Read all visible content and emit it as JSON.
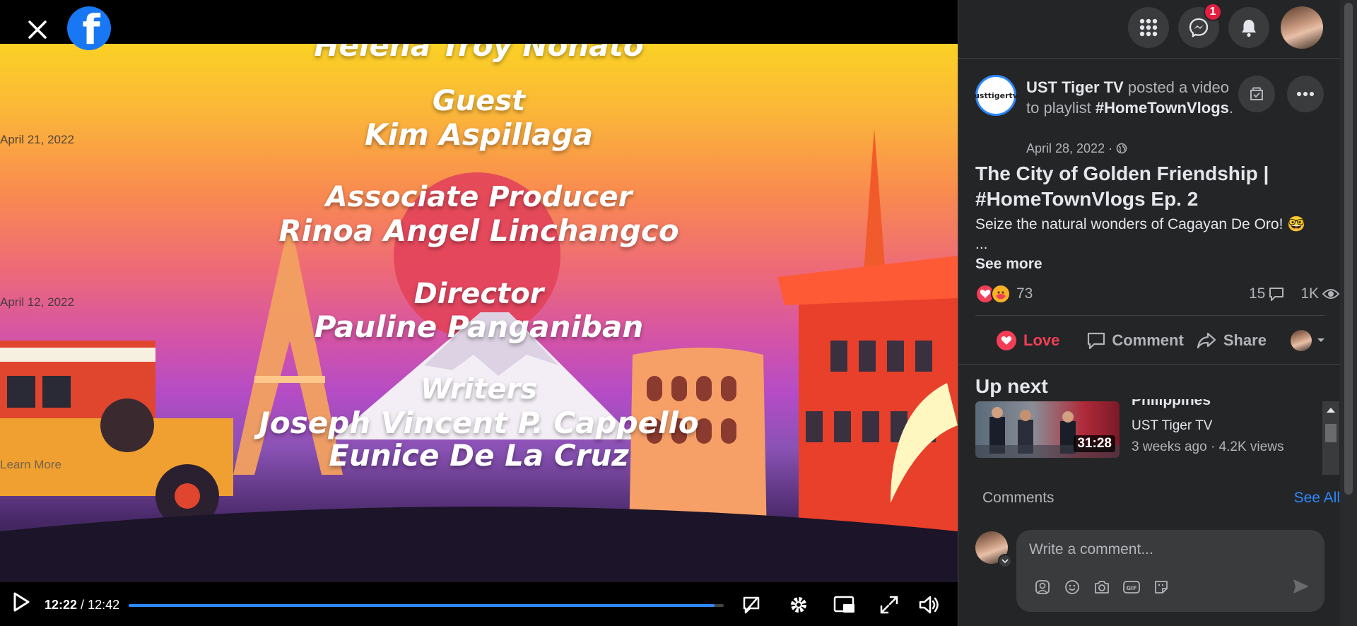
{
  "window": {
    "close_label": "Close",
    "logo": "facebook-logo"
  },
  "video": {
    "credits": [
      {
        "text": "Helena Troy Nonato",
        "kind": "name"
      },
      {
        "text": "Guest",
        "kind": "role"
      },
      {
        "text": "Kim Aspillaga",
        "kind": "name"
      },
      {
        "text": "Associate Producer",
        "kind": "role"
      },
      {
        "text": "Rinoa Angel Linchangco",
        "kind": "name"
      },
      {
        "text": "Director",
        "kind": "role"
      },
      {
        "text": "Pauline Panganiban",
        "kind": "name"
      },
      {
        "text": "Writers",
        "kind": "role"
      },
      {
        "text": "Joseph Vincent P. Cappello",
        "kind": "name"
      },
      {
        "text": "Eunice De La Cruz",
        "kind": "name"
      }
    ],
    "overlay_dates": [
      "April 21, 2022",
      "April 12, 2022"
    ],
    "overlay_learn_more": "Learn More",
    "current_time": "12:22",
    "separator": " / ",
    "duration": "12:42",
    "progress_fraction": 0.984
  },
  "topbar": {
    "notification_count": "1"
  },
  "post": {
    "page_name": "UST Tiger TV",
    "avatar_text": "usttigertv",
    "action_text": "posted a video to playlist",
    "playlist": "#HomeTownVlogs",
    "date": "April 28, 2022 ·",
    "title": "The City of Golden Friendship | #HomeTownVlogs Ep. 2",
    "description": "Seize the natural wonders of Cagayan De Oro! 🤓",
    "ellipsis": "...",
    "see_more": "See more",
    "reaction_count": "73",
    "comment_count": "15",
    "view_count": "1K"
  },
  "actions": {
    "love": "Love",
    "comment": "Comment",
    "share": "Share"
  },
  "up_next": {
    "heading": "Up next",
    "item": {
      "title": "Philippines",
      "channel": "UST Tiger TV",
      "meta": "3 weeks ago · 4.2K views",
      "duration": "31:28"
    }
  },
  "comments": {
    "label": "Comments",
    "see_all": "See All",
    "placeholder": "Write a comment..."
  },
  "colors": {
    "accent": "#2d88ff",
    "love": "#f33e58",
    "panel_bg": "#242526",
    "badge": "#e41e3f"
  }
}
